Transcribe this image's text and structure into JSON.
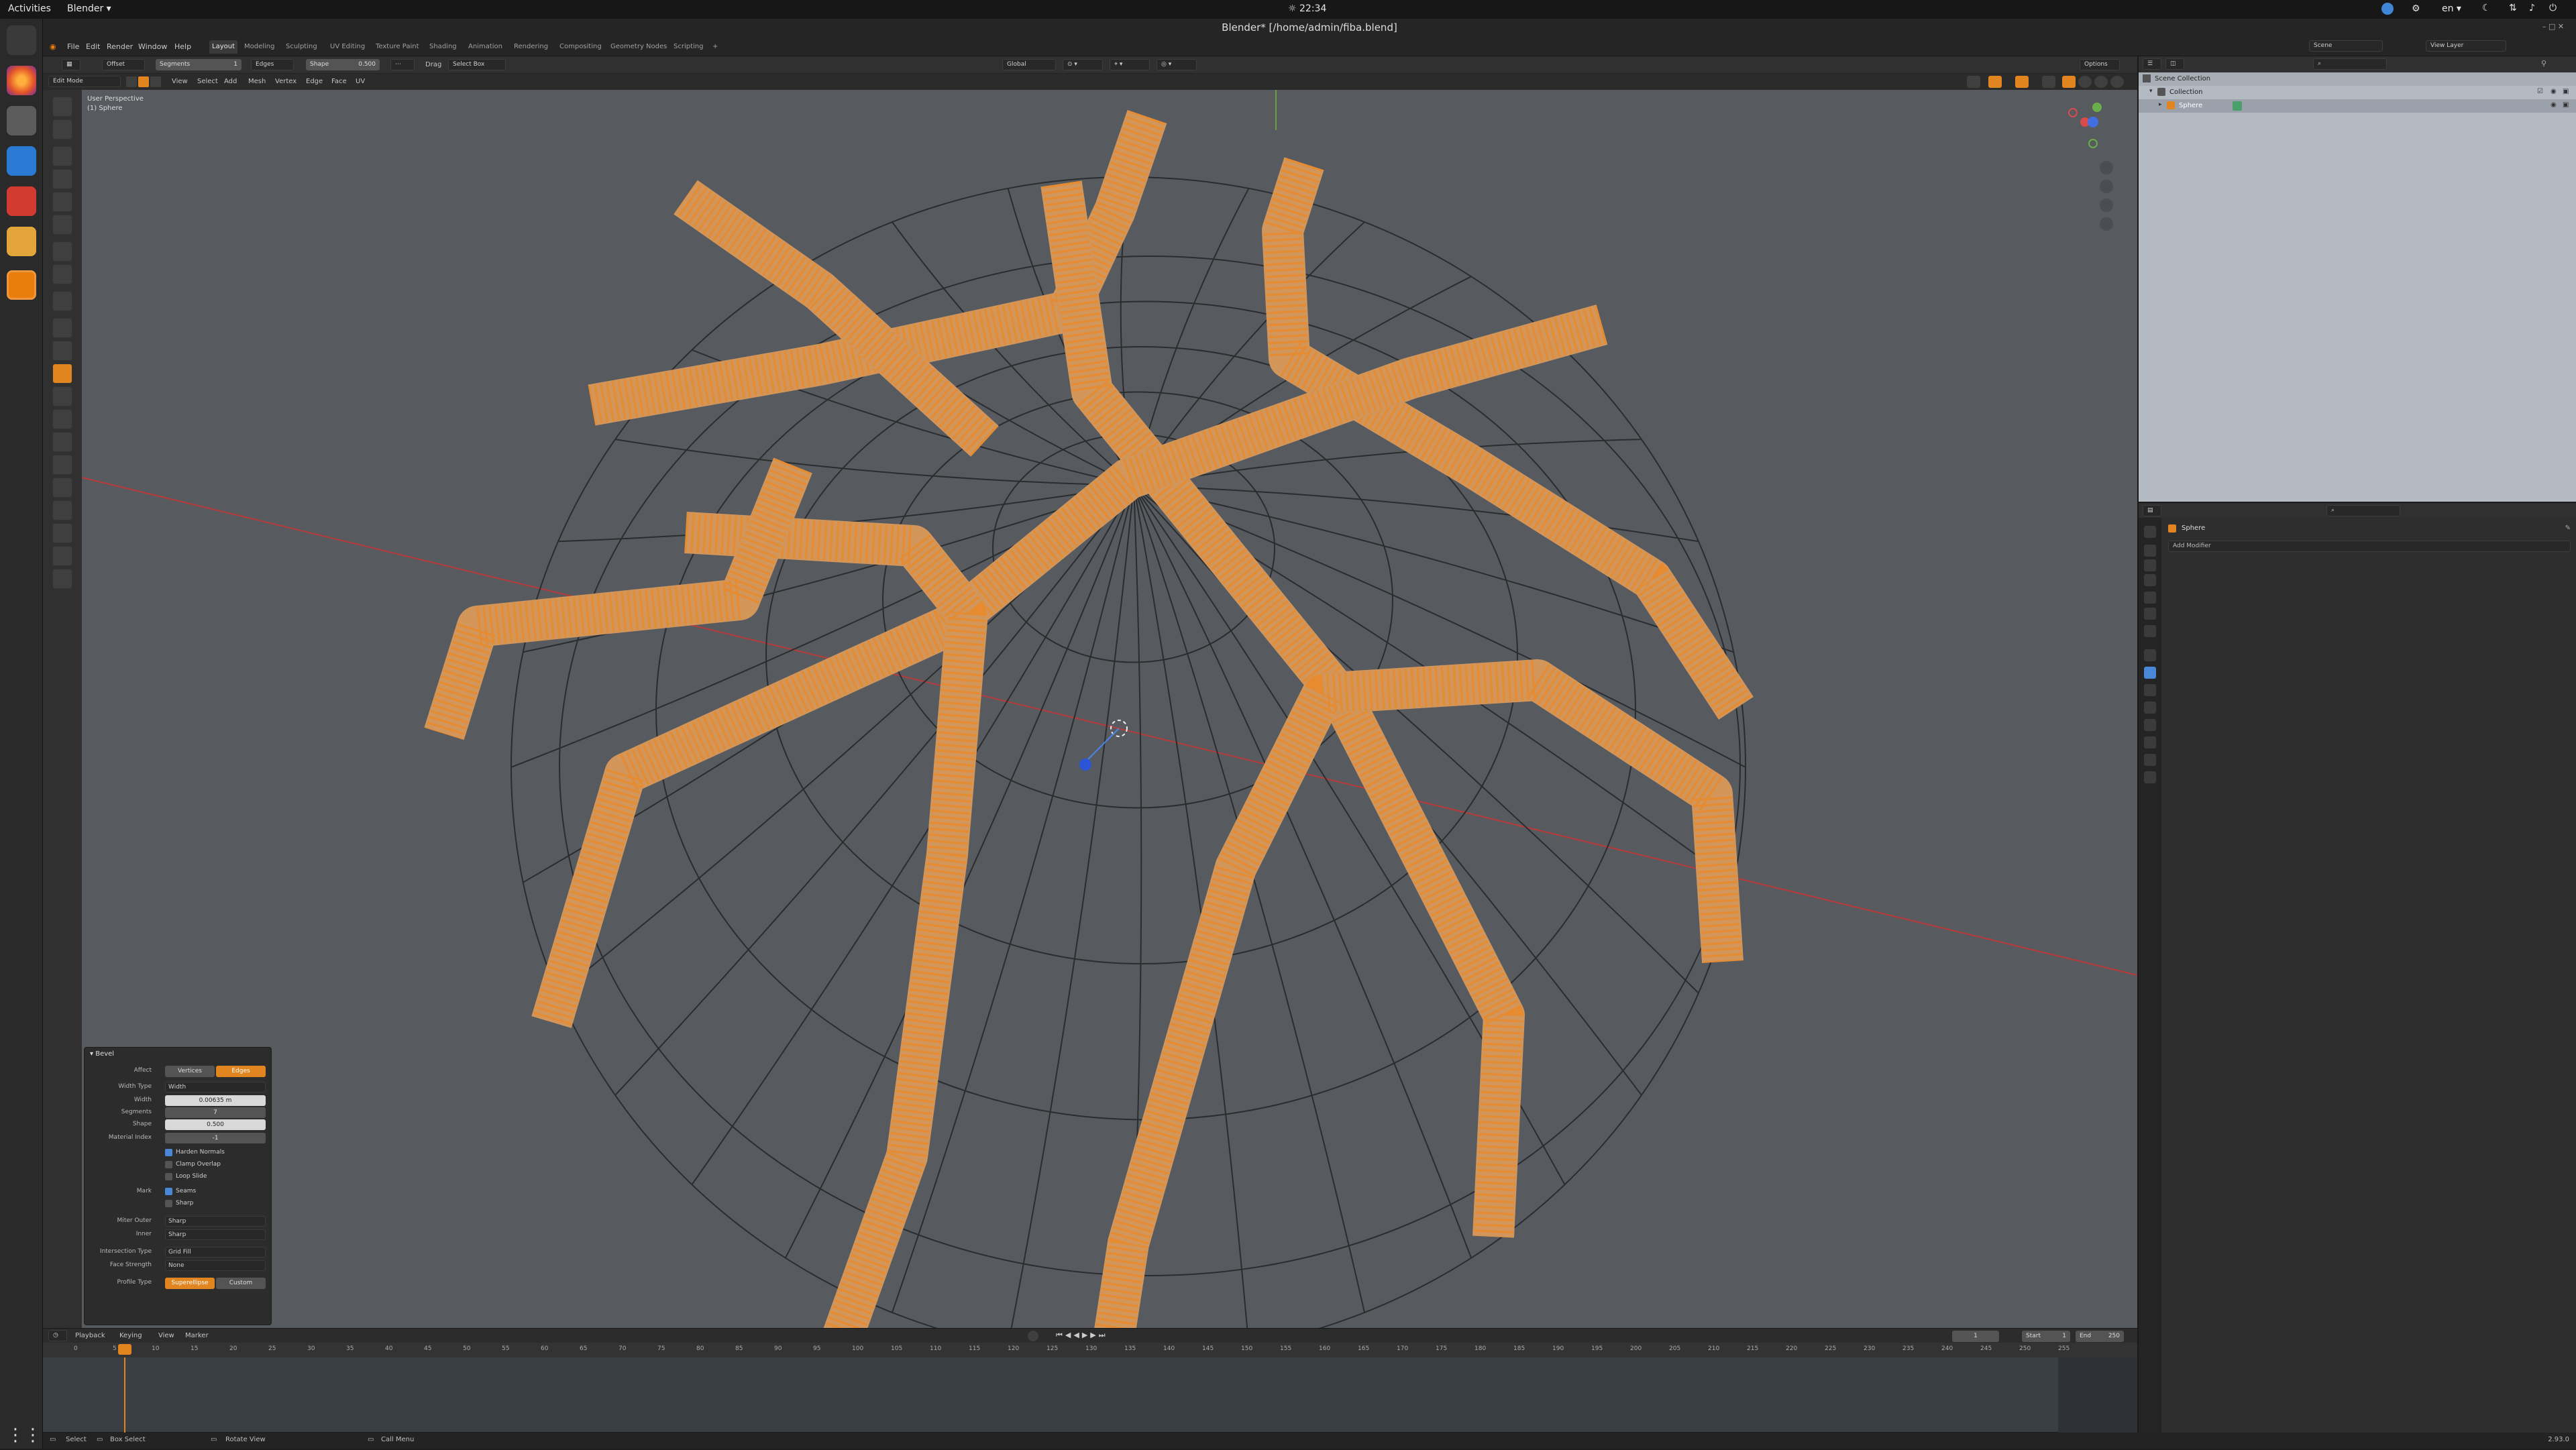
{
  "system": {
    "activities": "Activities",
    "app_menu": "Blender ▾",
    "clock": "☼ 22:34",
    "language": "en ▾"
  },
  "window": {
    "title": "Blender* [/home/admin/fiba.blend]"
  },
  "menu": [
    "File",
    "Edit",
    "Render",
    "Window",
    "Help"
  ],
  "workspaces": [
    "Layout",
    "Modeling",
    "Sculpting",
    "UV Editing",
    "Texture Paint",
    "Shading",
    "Animation",
    "Rendering",
    "Compositing",
    "Geometry Nodes",
    "Scripting"
  ],
  "active_workspace": "Layout",
  "scene": {
    "label": "Scene",
    "view_layer": "View Layer"
  },
  "tool_header": {
    "offset": "Offset",
    "segments_label": "Segments",
    "segments_value": "1",
    "affect": "Edges",
    "shape_label": "Shape",
    "shape_value": "0.500",
    "drag": "Drag",
    "select_box": "Select Box",
    "orientation": "Global",
    "options": "Options"
  },
  "edit_header": {
    "mode": "Edit Mode",
    "items": [
      "View",
      "Select",
      "Add",
      "Mesh",
      "Vertex",
      "Edge",
      "Face",
      "UV"
    ]
  },
  "viewport": {
    "perspective": "User Perspective",
    "object": "(1) Sphere"
  },
  "bevel_panel": {
    "title": "Bevel",
    "affect_label": "Affect",
    "affect_options": [
      "Vertices",
      "Edges"
    ],
    "affect_selected": "Edges",
    "width_type_label": "Width Type",
    "width_type": "Width",
    "width_label": "Width",
    "width": "0.00635 m",
    "segments_label": "Segments",
    "segments": "7",
    "shape_label": "Shape",
    "shape": "0.500",
    "material_label": "Material Index",
    "material": "-1",
    "checks": [
      {
        "label": "Harden Normals",
        "on": true
      },
      {
        "label": "Clamp Overlap",
        "on": false
      },
      {
        "label": "Loop Slide",
        "on": false
      }
    ],
    "mark_label": "Mark",
    "mark_checks": [
      {
        "label": "Seams",
        "on": true
      },
      {
        "label": "Sharp",
        "on": false
      }
    ],
    "miter_outer_label": "Miter Outer",
    "miter_outer": "Sharp",
    "inner_label": "Inner",
    "inner": "Sharp",
    "intersection_label": "Intersection Type",
    "intersection": "Grid Fill",
    "face_strength_label": "Face Strength",
    "face_strength": "None",
    "profile_label": "Profile Type",
    "profile_options": [
      "Superellipse",
      "Custom"
    ],
    "profile_selected": "Superellipse"
  },
  "timeline": {
    "menus": [
      "Playback",
      "Keying",
      "View",
      "Marker"
    ],
    "current_frame": "1",
    "start_label": "Start",
    "start": "1",
    "end_label": "End",
    "end": "250",
    "ticks": [
      "0",
      "5",
      "10",
      "15",
      "20",
      "25",
      "30",
      "35",
      "40",
      "45",
      "50",
      "55",
      "60",
      "65",
      "70",
      "75",
      "80",
      "85",
      "90",
      "95",
      "100",
      "105",
      "110",
      "115",
      "120",
      "125",
      "130",
      "135",
      "140",
      "145",
      "150",
      "155",
      "160",
      "165",
      "170",
      "175",
      "180",
      "185",
      "190",
      "195",
      "200",
      "205",
      "210",
      "215",
      "220",
      "225",
      "230",
      "235",
      "240",
      "245",
      "250",
      "255"
    ]
  },
  "status": {
    "select": "Select",
    "box_select": "Box Select",
    "rotate_view": "Rotate View",
    "call_menu": "Call Menu",
    "version": "2.93.0"
  },
  "outliner": {
    "scene_collection": "Scene Collection",
    "collection": "Collection",
    "object": "Sphere"
  },
  "properties": {
    "object": "Sphere",
    "add_modifier": "Add Modifier"
  },
  "colors": {
    "accent": "#e0851f",
    "viewport_bg": "#575b5f",
    "wire": "#2a2c2e",
    "x_axis": "#b83a3a"
  }
}
